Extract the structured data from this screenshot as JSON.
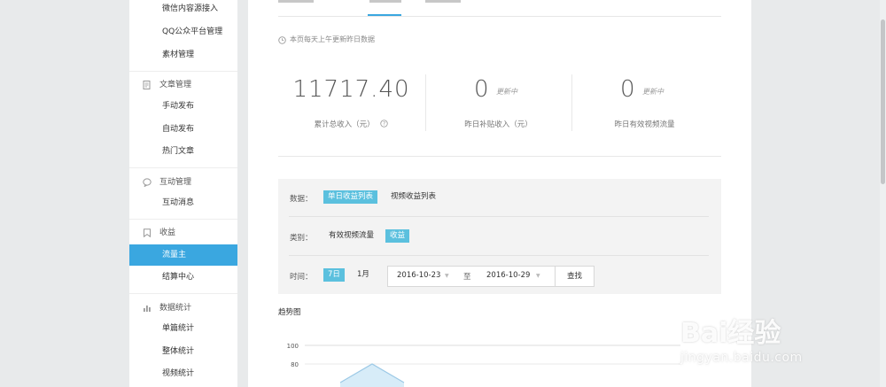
{
  "sidebar": {
    "items": [
      {
        "label": "微信内容源接入"
      },
      {
        "label": "QQ公众平台管理"
      },
      {
        "label": "素材管理"
      },
      {
        "label": "手动发布"
      },
      {
        "label": "自动发布"
      },
      {
        "label": "热门文章"
      },
      {
        "label": "互动消息"
      },
      {
        "label": "流量主",
        "active": true
      },
      {
        "label": "结算中心"
      },
      {
        "label": "单篇统计"
      },
      {
        "label": "整体统计"
      },
      {
        "label": "视频统计"
      }
    ],
    "groups": [
      {
        "label": "文章管理",
        "icon": "article-icon"
      },
      {
        "label": "互动管理",
        "icon": "chat-bubble-icon"
      },
      {
        "label": "收益",
        "icon": "bookmark-icon"
      },
      {
        "label": "数据统计",
        "icon": "bar-chart-icon"
      }
    ]
  },
  "notice": {
    "text": "本页每天上午更新昨日数据",
    "icon": "clock-icon"
  },
  "stats": [
    {
      "value": "11717.40",
      "caption": "累计总收入（元）",
      "help_icon": "question-circle-icon"
    },
    {
      "value": "0",
      "status": "更新中",
      "caption": "昨日补贴收入（元）"
    },
    {
      "value": "0",
      "status": "更新中",
      "caption": "昨日有效视频流量"
    }
  ],
  "filters": {
    "data_label": "数据：",
    "data_options": [
      {
        "label": "单日收益列表",
        "selected": true
      },
      {
        "label": "视频收益列表",
        "selected": false
      }
    ],
    "category_label": "类别：",
    "category_options": [
      {
        "label": "有效视频流量",
        "selected": false
      },
      {
        "label": "收益",
        "selected": true
      }
    ],
    "time_label": "时间：",
    "time_options": [
      {
        "label": "7日",
        "selected": true
      },
      {
        "label": "1月",
        "selected": false
      }
    ],
    "date_start": "2016-10-23",
    "date_sep": "至",
    "date_end": "2016-10-29",
    "search_label": "查找"
  },
  "trend": {
    "title": "趋势图"
  },
  "chart_data": {
    "type": "area",
    "title": "",
    "y_ticks": [
      "100",
      "80"
    ],
    "ylim": [
      0,
      100
    ],
    "series": [
      {
        "values": [
          60,
          80,
          60
        ]
      }
    ],
    "grid": true
  },
  "watermark": {
    "brand": "Bai经验",
    "url": "jingyan.baidu.com"
  },
  "colors": {
    "accent": "#3aa7e0",
    "chip": "#5bc0de"
  }
}
